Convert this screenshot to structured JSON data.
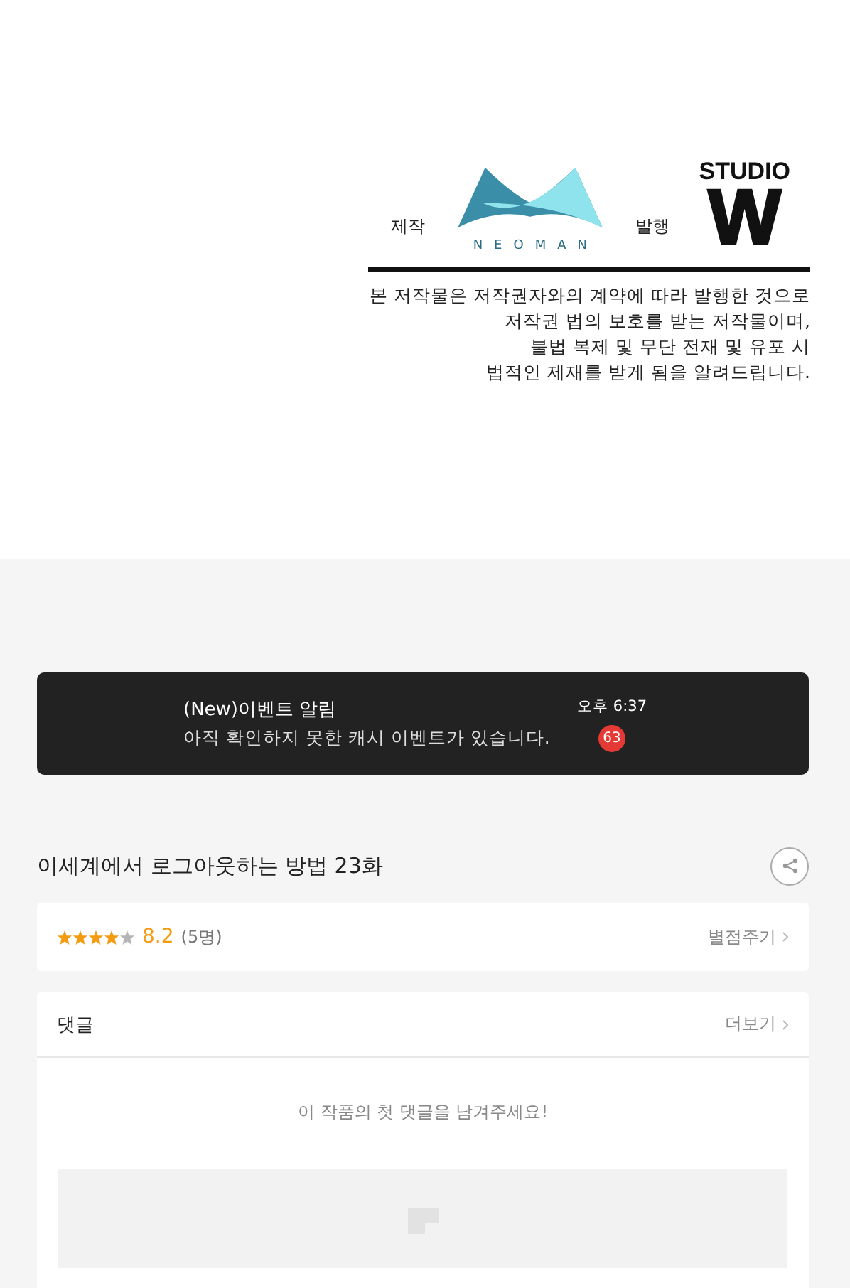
{
  "credits": {
    "producer_label": "제작",
    "producer_logo": "NEOMAN",
    "publisher_label": "발행",
    "publisher_logo_top": "STUDIO",
    "publisher_logo_letter": "W",
    "notice": [
      "본 저작물은 저작권자와의 계약에 따라 발행한 것으로",
      "저작권 법의 보호를 받는 저작물이며,",
      "불법 복제 및 무단 전재 및 유포 시",
      "법적인 제재를 받게 됨을 알려드립니다."
    ]
  },
  "notification": {
    "title": "(New)이벤트 알림",
    "message": "아직 확인하지 못한 캐시 이벤트가 있습니다.",
    "time": "오후 6:37",
    "badge": "63"
  },
  "episode": {
    "title": "이세계에서 로그아웃하는 방법 23화"
  },
  "rating": {
    "stars": 4,
    "score": "8.2",
    "count": "(5명)",
    "action": "별점주기"
  },
  "comments": {
    "title": "댓글",
    "more": "더보기",
    "empty": "이 작품의 첫 댓글을 남겨주세요!"
  }
}
